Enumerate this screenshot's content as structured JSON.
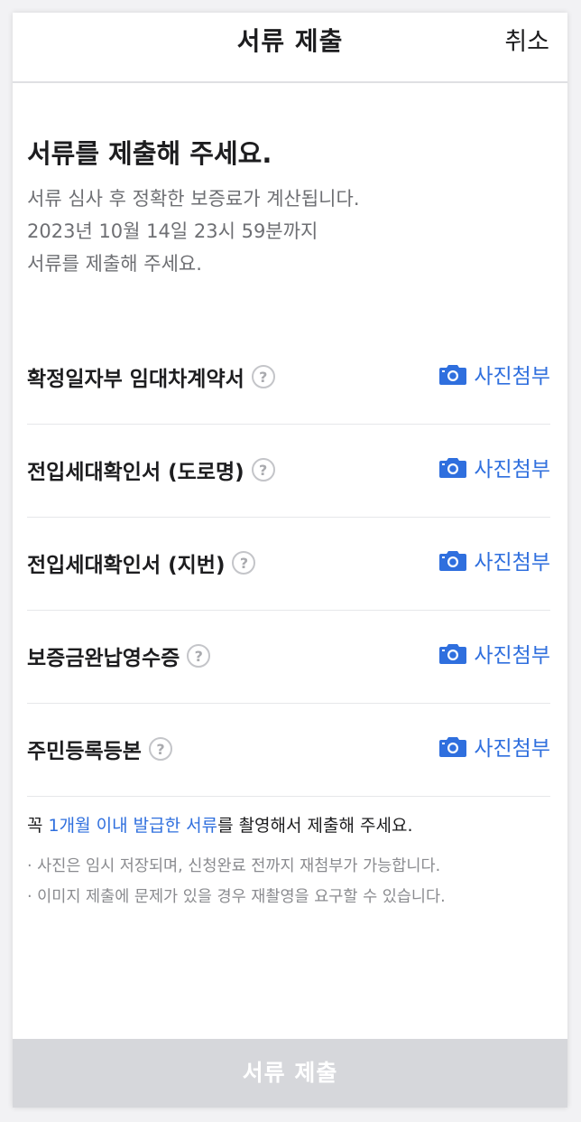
{
  "header": {
    "title": "서류 제출",
    "cancel_label": "취소"
  },
  "intro": {
    "title": "서류를 제출해 주세요.",
    "desc_line1": "서류 심사 후 정확한 보증료가 계산됩니다.",
    "desc_line2": "2023년 10월 14일 23시 59분까지",
    "desc_line3": "서류를 제출해 주세요."
  },
  "documents": [
    {
      "name": "확정일자부 임대차계약서",
      "attach_label": "사진첨부"
    },
    {
      "name": "전입세대확인서 (도로명)",
      "attach_label": "사진첨부"
    },
    {
      "name": "전입세대확인서 (지번)",
      "attach_label": "사진첨부"
    },
    {
      "name": "보증금완납영수증",
      "attach_label": "사진첨부"
    },
    {
      "name": "주민등록등본",
      "attach_label": "사진첨부"
    }
  ],
  "help_glyph": "?",
  "notice": {
    "prefix": "꼭 ",
    "highlight": "1개월 이내 발급한 서류",
    "suffix": "를 촬영해서 제출해 주세요."
  },
  "bullets": [
    "· 사진은 임시 저장되며, 신청완료 전까지 재첨부가 가능합니다.",
    "· 이미지 제출에 문제가 있을 경우 재촬영을 요구할 수 있습니다."
  ],
  "submit_label": "서류 제출",
  "colors": {
    "accent": "#2f6fde",
    "disabled_button": "#d6d7db"
  },
  "icons": {
    "attach": "camera-icon",
    "help": "help-circle-icon"
  }
}
